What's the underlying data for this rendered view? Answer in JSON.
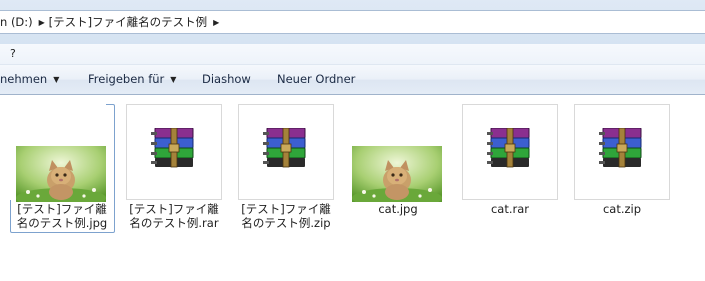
{
  "address": {
    "crumbs": [
      "n (D:)",
      "[テスト]ファイ離名のテスト例"
    ]
  },
  "menubar": {
    "item": "?"
  },
  "toolbar": {
    "buttons": [
      {
        "label": "nehmen",
        "dropdown": true
      },
      {
        "label": "Freigeben für",
        "dropdown": true
      },
      {
        "label": "Diashow",
        "dropdown": false
      },
      {
        "label": "Neuer Ordner",
        "dropdown": false
      }
    ]
  },
  "files": [
    {
      "name": "[テスト]ファイ離\n名のテスト例.jpg",
      "type": "jpg",
      "selected": true
    },
    {
      "name": "[テスト]ファイ離\n名のテスト例.rar",
      "type": "rar",
      "selected": false
    },
    {
      "name": "[テスト]ファイ離\n名のテスト例.zip",
      "type": "zip",
      "selected": false
    },
    {
      "name": "cat.jpg",
      "type": "jpg",
      "selected": false
    },
    {
      "name": "cat.rar",
      "type": "rar",
      "selected": false
    },
    {
      "name": "cat.zip",
      "type": "zip",
      "selected": false
    }
  ],
  "colors": {
    "toolbar_text": "#1b2a44",
    "selection_border": "#7da2ce",
    "thumb_border": "#d9d9d9"
  }
}
